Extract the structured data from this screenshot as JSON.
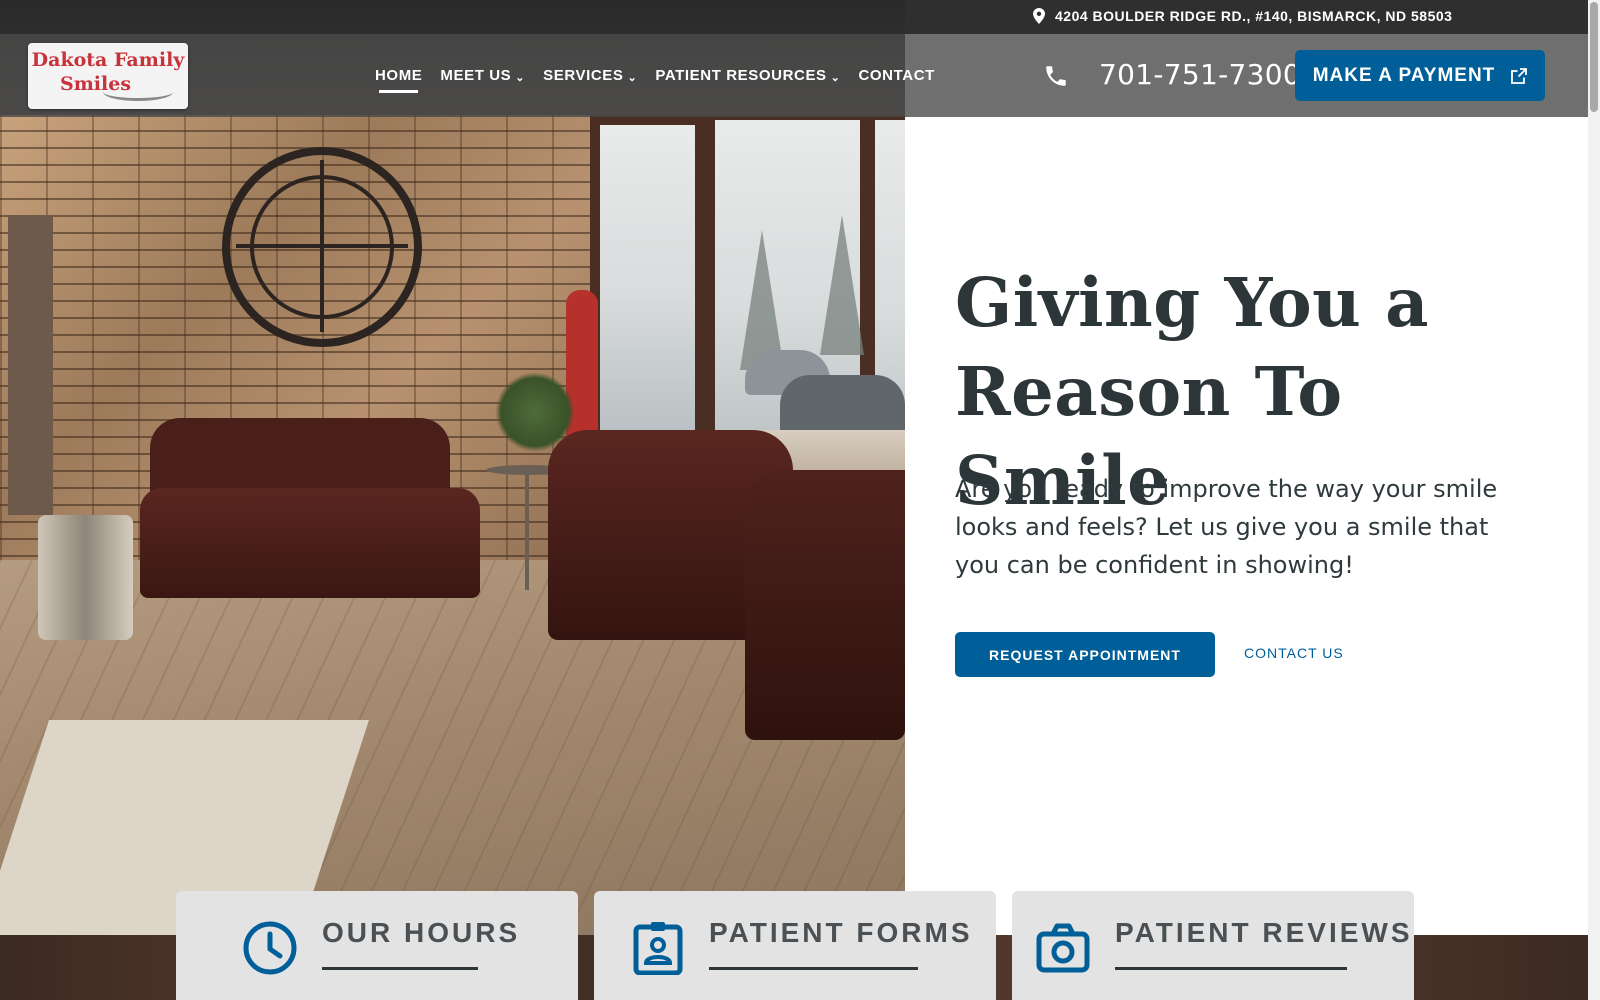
{
  "top_bar": {
    "address": "4204 BOULDER RIDGE RD., #140, BISMARCK, ND 58503",
    "address_icon": "map-pin-icon"
  },
  "logo": {
    "line1": "Dakota Family",
    "line2": "Smiles"
  },
  "nav": {
    "items": [
      {
        "label": "HOME",
        "active": true,
        "has_dropdown": false
      },
      {
        "label": "MEET US",
        "active": false,
        "has_dropdown": true
      },
      {
        "label": "SERVICES",
        "active": false,
        "has_dropdown": true
      },
      {
        "label": "PATIENT RESOURCES",
        "active": false,
        "has_dropdown": true
      },
      {
        "label": "CONTACT",
        "active": false,
        "has_dropdown": false
      }
    ],
    "dropdown_glyph": "⌄"
  },
  "header": {
    "phone_icon": "phone-icon",
    "phone": "701-751-7300",
    "payment_label": "MAKE A PAYMENT",
    "payment_icon": "external-link-icon"
  },
  "hero": {
    "headline_line1": "Giving You a",
    "headline_line2": "Reason To Smile",
    "subtext": "Are you ready to improve the way your smile looks and feels? Let us give you a smile that you can be confident in showing!",
    "primary_cta": "REQUEST APPOINTMENT",
    "secondary_cta": "CONTACT US"
  },
  "cards": [
    {
      "title": "OUR HOURS",
      "icon": "clock-icon"
    },
    {
      "title": "PATIENT FORMS",
      "icon": "id-badge-icon"
    },
    {
      "title": "PATIENT REVIEWS",
      "icon": "camera-icon"
    }
  ],
  "colors": {
    "brand_blue": "#005f99",
    "heading_text": "#2c3538",
    "logo_red": "#c8323a",
    "card_bg": "#e3e3e3"
  }
}
